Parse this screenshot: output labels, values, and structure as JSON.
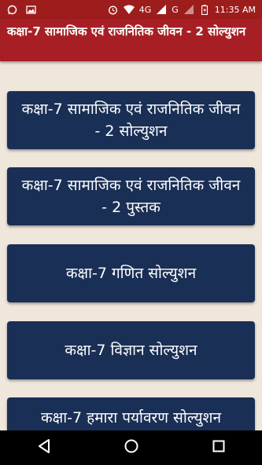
{
  "status_bar": {
    "network_4g": "4G",
    "network_g": "G",
    "time": "11:35 AM",
    "icons": [
      "whatsapp-icon",
      "photo-icon",
      "alarm-icon",
      "wifi-icon",
      "signal-icon",
      "battery-icon"
    ]
  },
  "app_bar": {
    "title": "कक्षा-7 सामाजिक एवं राजनितिक जीवन - 2 सोल्युशन",
    "color": "#a71f24"
  },
  "menu": {
    "button_color": "#1a2f55",
    "items": [
      {
        "label": "कक्षा-7 सामाजिक एवं राजनितिक जीवन - 2 सोल्युशन"
      },
      {
        "label": "कक्षा-7 सामाजिक एवं राजनितिक जीवन - 2 पुस्तक"
      },
      {
        "label": "कक्षा-7 गणित सोल्युशन"
      },
      {
        "label": "कक्षा-7 विज्ञान सोल्युशन"
      },
      {
        "label": "कक्षा-7 हमारा पर्यावरण सोल्युशन"
      }
    ]
  },
  "nav_bar": {
    "icons": [
      "back-icon",
      "home-icon",
      "recents-icon"
    ]
  }
}
